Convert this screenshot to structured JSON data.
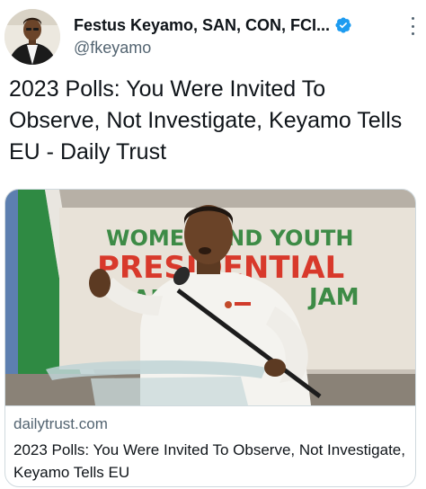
{
  "tweet": {
    "author_name": "Festus Keyamo, SAN, CON, FCI...",
    "author_handle": "@fkeyamo",
    "text": "2023 Polls: You Were Invited To Observe, Not Investigate, Keyamo Tells EU - Daily Trust"
  },
  "card": {
    "domain": "dailytrust.com",
    "title": "2023 Polls: You Were Invited To Observe, Not Investigate, Keyamo Tells EU",
    "banner_text": [
      "WOMEN AND YOUTH",
      "PRESIDENTIAL",
      "CAMPAIGN",
      "JAM"
    ]
  },
  "icons": {
    "verified": "verified-badge-icon",
    "more": "more-options-icon"
  },
  "colors": {
    "verified_blue": "#1d9bf0",
    "secondary_text": "#536471",
    "primary_text": "#0f1419",
    "border": "#cfd9de"
  }
}
